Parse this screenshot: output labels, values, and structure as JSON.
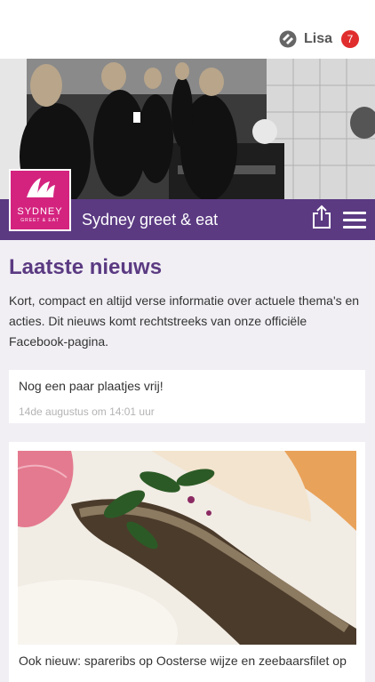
{
  "user": {
    "name": "Lisa",
    "notifications": "7",
    "logo_icon": "diamond-logo-icon"
  },
  "brand": {
    "name": "SYDNEY",
    "tagline": "GREET & EAT"
  },
  "header": {
    "title": "Sydney greet & eat",
    "share_icon": "share-icon",
    "menu_icon": "hamburger-menu-icon"
  },
  "main": {
    "heading": "Laatste nieuws",
    "intro": "Kort, compact en altijd verse informatie over actuele thema's en acties. Dit nieuws komt rechtstreeks van onze officiële Facebook-pagina."
  },
  "posts": [
    {
      "title": "Nog een paar plaatjes vrij!",
      "date": "14de augustus om 14:01 uur"
    },
    {
      "title": "Ook nieuw: spareribs op Oosterse wijze en zeebaarsfilet op"
    }
  ],
  "colors": {
    "accent": "#5b3a82",
    "brand": "#d4237f",
    "badge": "#e02d2d"
  }
}
